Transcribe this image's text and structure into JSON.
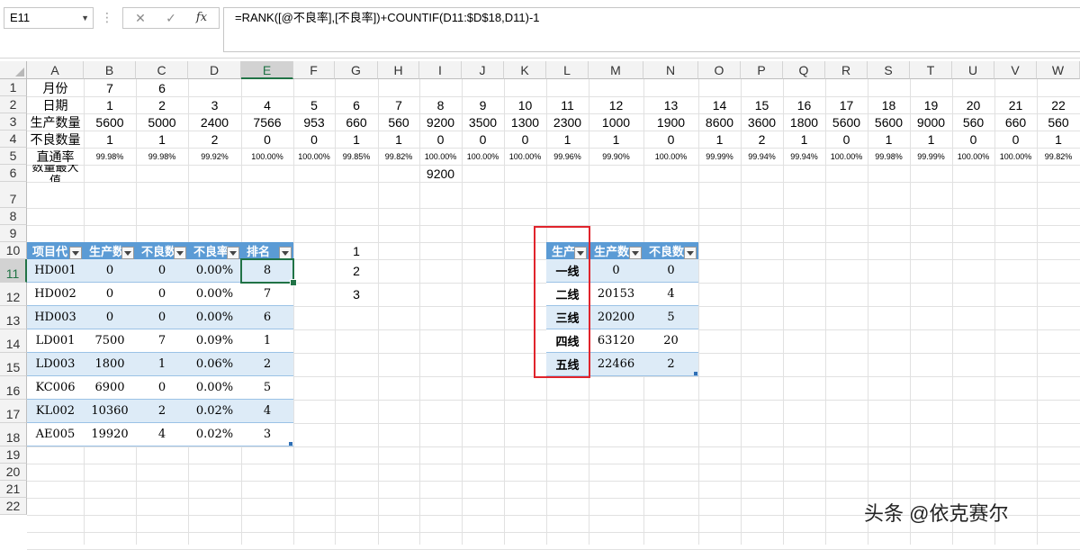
{
  "formula_bar": {
    "name_box": "E11",
    "dots": "⋮",
    "cancel_icon": "✕",
    "enter_icon": "✓",
    "fx_label": "fx",
    "formula": "=RANK([@不良率],[不良率])+COUNTIF(D11:$D$18,D11)-1"
  },
  "columns": [
    "A",
    "B",
    "C",
    "D",
    "E",
    "F",
    "G",
    "H",
    "I",
    "J",
    "K",
    "L",
    "M",
    "N",
    "O",
    "P",
    "Q",
    "R",
    "S",
    "T",
    "U",
    "V",
    "W"
  ],
  "rows": [
    "1",
    "2",
    "3",
    "4",
    "5",
    "6",
    "7",
    "8",
    "9",
    "10",
    "11",
    "12",
    "13",
    "14",
    "15",
    "16",
    "17",
    "18",
    "19",
    "20",
    "21",
    "22"
  ],
  "sheet": {
    "row1": [
      "月份",
      "7",
      "6"
    ],
    "row2": [
      "日期",
      "1",
      "2",
      "3",
      "4",
      "5",
      "6",
      "7",
      "8",
      "9",
      "10",
      "11",
      "12",
      "13",
      "14",
      "15",
      "16",
      "17",
      "18",
      "19",
      "20",
      "21",
      "22"
    ],
    "row3": [
      "生产数量",
      "5600",
      "5000",
      "2400",
      "7566",
      "953",
      "660",
      "560",
      "9200",
      "3500",
      "1300",
      "2300",
      "1000",
      "1900",
      "8600",
      "3600",
      "1800",
      "5600",
      "5600",
      "9000",
      "560",
      "660",
      "560"
    ],
    "row4": [
      "不良数量",
      "1",
      "1",
      "2",
      "0",
      "0",
      "1",
      "1",
      "0",
      "0",
      "0",
      "1",
      "1",
      "0",
      "1",
      "2",
      "1",
      "0",
      "1",
      "1",
      "0",
      "0",
      "1"
    ],
    "row5": [
      "直通率",
      "99.98%",
      "99.98%",
      "99.92%",
      "100.00%",
      "100.00%",
      "99.85%",
      "99.82%",
      "100.00%",
      "100.00%",
      "100.00%",
      "99.96%",
      "99.90%",
      "100.00%",
      "99.99%",
      "99.94%",
      "99.94%",
      "100.00%",
      "99.98%",
      "99.99%",
      "100.00%",
      "100.00%",
      "99.82%"
    ],
    "row6_label": "数量最大值",
    "row6_value": "9200",
    "g_numbers": [
      "1",
      "2",
      "3"
    ]
  },
  "table1": {
    "headers": [
      "项目代",
      "生产数",
      "不良数",
      "不良率",
      "排名"
    ],
    "rows": [
      [
        "HD001",
        "0",
        "0",
        "0.00%",
        "8"
      ],
      [
        "HD002",
        "0",
        "0",
        "0.00%",
        "7"
      ],
      [
        "HD003",
        "0",
        "0",
        "0.00%",
        "6"
      ],
      [
        "LD001",
        "7500",
        "7",
        "0.09%",
        "1"
      ],
      [
        "LD003",
        "1800",
        "1",
        "0.06%",
        "2"
      ],
      [
        "KC006",
        "6900",
        "0",
        "0.00%",
        "5"
      ],
      [
        "KL002",
        "10360",
        "2",
        "0.02%",
        "4"
      ],
      [
        "AE005",
        "19920",
        "4",
        "0.02%",
        "3"
      ]
    ]
  },
  "table2": {
    "headers": [
      "生产",
      "生产数",
      "不良数"
    ],
    "rows": [
      [
        "一线",
        "0",
        "0"
      ],
      [
        "二线",
        "20153",
        "4"
      ],
      [
        "三线",
        "20200",
        "5"
      ],
      [
        "四线",
        "63120",
        "20"
      ],
      [
        "五线",
        "22466",
        "2"
      ]
    ]
  },
  "watermark": "头条 @依克赛尔",
  "colors": {
    "header_blue": "#5b9bd5",
    "band_blue": "#ddebf7",
    "active_green": "#217346",
    "highlight_red": "#e0242c"
  }
}
